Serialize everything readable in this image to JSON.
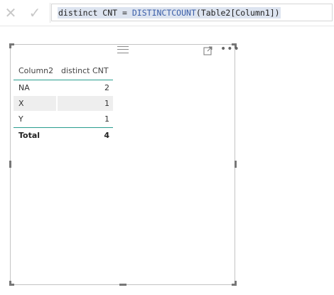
{
  "formula_bar": {
    "cancel_icon": "close-icon",
    "commit_icon": "checkmark-icon",
    "measure_name": "distinct CNT",
    "operator": " = ",
    "function_name": "DISTINCTCOUNT",
    "function_args": "(Table2[Column1])"
  },
  "visual": {
    "header_icons": [
      "drag-grip-icon",
      "focus-mode-icon",
      "more-options-icon"
    ],
    "table": {
      "columns": [
        "Column2",
        "distinct CNT"
      ],
      "rows": [
        {
          "label": "NA",
          "value": "2"
        },
        {
          "label": "X",
          "value": "1"
        },
        {
          "label": "Y",
          "value": "1"
        }
      ],
      "total": {
        "label": "Total",
        "value": "4"
      }
    }
  },
  "colors": {
    "accent": "#2a9d8f",
    "selection": "#dde4f0",
    "function_text": "#3a5ea8",
    "row_shade": "#eeeeee"
  }
}
